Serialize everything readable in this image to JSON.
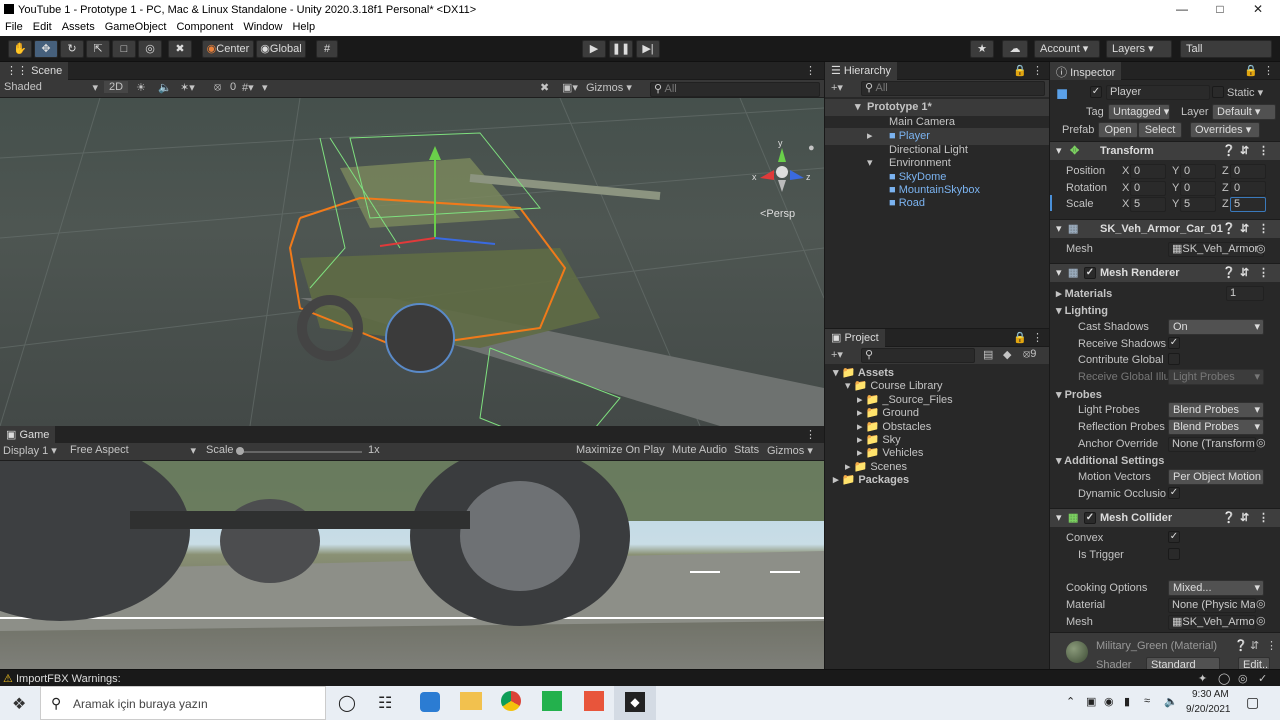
{
  "window": {
    "title": "YouTube 1 - Prototype 1 - PC, Mac & Linux Standalone - Unity 2020.3.18f1 Personal* <DX11>"
  },
  "menu": [
    "File",
    "Edit",
    "Assets",
    "GameObject",
    "Component",
    "Window",
    "Help"
  ],
  "toolbar": {
    "center": "Center",
    "global": "Global",
    "account": "Account",
    "layers": "Layers",
    "layout": "Tall"
  },
  "scene": {
    "tab": "Scene",
    "shading": "Shaded",
    "mode2d": "2D",
    "fx_count": "0",
    "gizmos": "Gizmos",
    "search_placeholder": "All",
    "persp": "<Persp"
  },
  "game": {
    "tab": "Game",
    "display": "Display 1",
    "aspect": "Free Aspect",
    "scale_label": "Scale",
    "scale_value": "1x",
    "maximize": "Maximize On Play",
    "mute": "Mute Audio",
    "stats": "Stats",
    "gizmos": "Gizmos"
  },
  "hierarchy": {
    "tab": "Hierarchy",
    "search_placeholder": "All",
    "items": [
      {
        "label": "Prototype 1*"
      },
      {
        "label": "Main Camera"
      },
      {
        "label": "Player"
      },
      {
        "label": "Directional Light"
      },
      {
        "label": "Environment"
      },
      {
        "label": "SkyDome"
      },
      {
        "label": "MountainSkybox"
      },
      {
        "label": "Road"
      }
    ]
  },
  "project": {
    "tab": "Project",
    "hidden_count": "9",
    "items": [
      {
        "label": "Assets"
      },
      {
        "label": "Course Library"
      },
      {
        "label": "_Source_Files"
      },
      {
        "label": "Ground"
      },
      {
        "label": "Obstacles"
      },
      {
        "label": "Sky"
      },
      {
        "label": "Vehicles"
      },
      {
        "label": "Scenes"
      },
      {
        "label": "Packages"
      }
    ]
  },
  "inspector": {
    "tab": "Inspector",
    "name": "Player",
    "static": "Static",
    "tag_label": "Tag",
    "tag": "Untagged",
    "layer_label": "Layer",
    "layer": "Default",
    "prefab_label": "Prefab",
    "open": "Open",
    "select": "Select",
    "overrides": "Overrides",
    "transform": {
      "title": "Transform",
      "position": {
        "label": "Position",
        "x": "0",
        "y": "0",
        "z": "0"
      },
      "rotation": {
        "label": "Rotation",
        "x": "0",
        "y": "0",
        "z": "0"
      },
      "scale": {
        "label": "Scale",
        "x": "5",
        "y": "5",
        "z": "5"
      },
      "x": "X",
      "y": "Y",
      "z": "Z"
    },
    "mesh_filter": {
      "title": "SK_Veh_Armor_Car_01",
      "mesh_label": "Mesh",
      "mesh": "SK_Veh_Armor"
    },
    "mesh_renderer": {
      "title": "Mesh Renderer",
      "materials": "Materials",
      "materials_count": "1",
      "lighting": "Lighting",
      "cast_shadows": "Cast Shadows",
      "cast_shadows_value": "On",
      "receive_shadows": "Receive Shadows",
      "contribute_gi": "Contribute Global",
      "receive_gi": "Receive Global Illu",
      "receive_gi_value": "Light Probes",
      "probes": "Probes",
      "light_probes": "Light Probes",
      "light_probes_value": "Blend Probes",
      "reflection_probes": "Reflection Probes",
      "reflection_probes_value": "Blend Probes",
      "anchor_override": "Anchor Override",
      "anchor_override_value": "None (Transform",
      "additional": "Additional Settings",
      "motion_vectors": "Motion Vectors",
      "motion_vectors_value": "Per Object Motion",
      "dynamic_occlusion": "Dynamic Occlusio"
    },
    "mesh_collider": {
      "title": "Mesh Collider",
      "convex": "Convex",
      "is_trigger": "Is Trigger",
      "cooking": "Cooking Options",
      "cooking_value": "Mixed...",
      "material_label": "Material",
      "material_value": "None (Physic Ma",
      "mesh_label": "Mesh",
      "mesh_value": "SK_Veh_Armor"
    },
    "material": {
      "title": "Military_Green (Material)",
      "shader_label": "Shader",
      "shader": "Standard",
      "edit": "Edit..."
    }
  },
  "status": {
    "warning": "ImportFBX Warnings:"
  },
  "taskbar": {
    "search": "Aramak için buraya yazın",
    "time": "9:30 AM",
    "date": "9/20/2021"
  },
  "colors": {
    "accent": "#2c5d87",
    "prefab_blue": "#7bb3f0",
    "wire_orange": "#f07a1a",
    "wire_green": "#7fe07f"
  }
}
